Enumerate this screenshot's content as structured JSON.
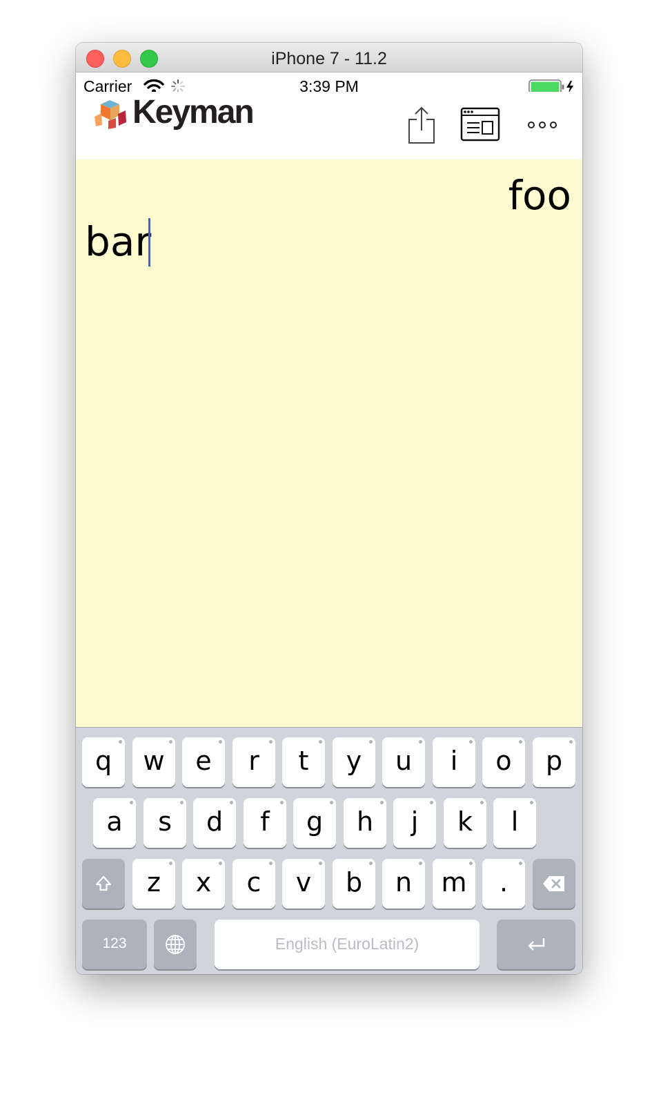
{
  "window": {
    "title": "iPhone 7 - 11.2"
  },
  "status_bar": {
    "carrier": "Carrier",
    "time": "3:39 PM",
    "wifi_icon": "wifi-icon",
    "activity_icon": "spinner-icon",
    "battery_icon": "battery-charging-icon"
  },
  "app": {
    "logo_text": "Keyman",
    "actions": [
      "share-icon",
      "keyboard-settings-icon",
      "more-icon"
    ],
    "band_colors": [
      "#f07730",
      "#b7263b",
      "#72b6d2"
    ]
  },
  "editor": {
    "line1": "foo",
    "line2": "bar",
    "background": "#fffbd1"
  },
  "keyboard": {
    "row1": [
      "q",
      "w",
      "e",
      "r",
      "t",
      "y",
      "u",
      "i",
      "o",
      "p"
    ],
    "row2": [
      "a",
      "s",
      "d",
      "f",
      "g",
      "h",
      "j",
      "k",
      "l"
    ],
    "row3": [
      "z",
      "x",
      "c",
      "v",
      "b",
      "n",
      "m",
      "."
    ],
    "numbers_label": "123",
    "space_label": "English (EuroLatin2)",
    "icons": {
      "shift": "shift-icon",
      "backspace": "backspace-icon",
      "globe": "globe-icon",
      "return": "return-icon"
    }
  }
}
